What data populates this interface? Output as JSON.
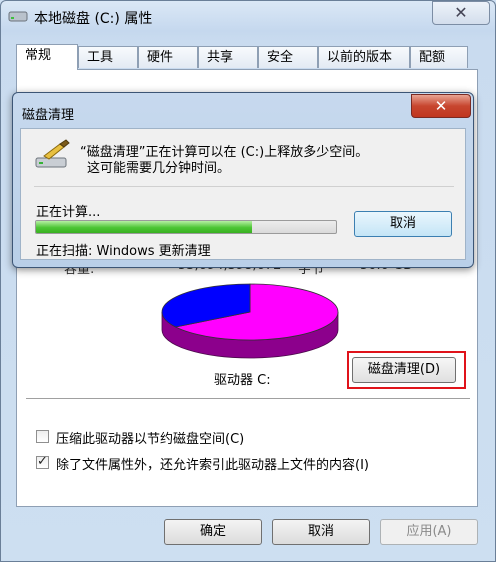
{
  "window": {
    "title": "本地磁盘 (C:) 属性",
    "close_glyph": "✕"
  },
  "tabs": [
    {
      "label": "常规"
    },
    {
      "label": "工具"
    },
    {
      "label": "硬件"
    },
    {
      "label": "共享"
    },
    {
      "label": "安全"
    },
    {
      "label": "以前的版本"
    },
    {
      "label": "配额"
    }
  ],
  "general": {
    "capacity_label": "容量:",
    "capacity_bytes": "53,694,398,672",
    "capacity_unit": "字节",
    "capacity_gb": "50.0 GB",
    "drive_label": "驱动器 C:",
    "cleanup_button": "磁盘清理(D)",
    "pie": {
      "used_fraction": 0.66,
      "free_fraction": 0.34,
      "used_color": "#ff00ff",
      "free_color": "#0000ff"
    },
    "compress_checkbox": {
      "label": "压缩此驱动器以节约磁盘空间(C)",
      "checked": false
    },
    "index_checkbox": {
      "label": "除了文件属性外，还允许索引此驱动器上文件的内容(I)",
      "checked": true,
      "check_glyph": "✓"
    }
  },
  "buttons": {
    "ok": "确定",
    "cancel": "取消",
    "apply": "应用(A)"
  },
  "dialog": {
    "title": "磁盘清理",
    "close_glyph": "✕",
    "message_line1": "“磁盘清理”正在计算可以在 (C:)上释放多少空间。",
    "message_line2": "这可能需要几分钟时间。",
    "calculating": "正在计算...",
    "progress_fraction": 0.72,
    "cancel": "取消",
    "scanning": "正在扫描:  Windows 更新清理",
    "icon": "disk-cleanup-icon"
  }
}
